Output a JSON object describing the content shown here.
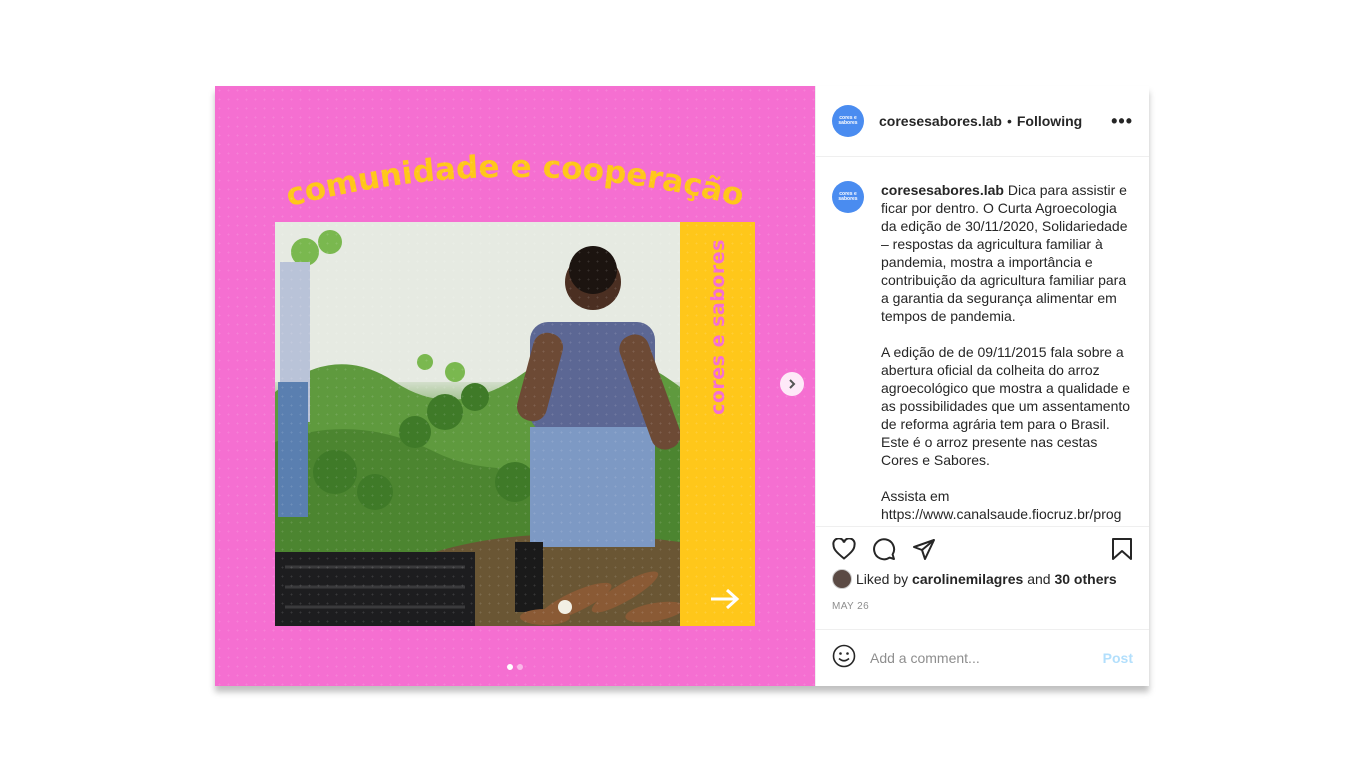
{
  "media": {
    "headline": "comunidade e cooperação",
    "brand_vertical": "cores e sabores",
    "colors": {
      "background": "#f56fd1",
      "band": "#ffc71a",
      "headline": "#ffc71a"
    },
    "slide_total": 2,
    "slide_current": 1,
    "next_icon": "chevron-right-icon"
  },
  "header": {
    "avatar_text": "cores e sabores",
    "username": "coresesabores.lab",
    "separator": "•",
    "follow_status": "Following",
    "more_icon": "more-options-icon",
    "more_label": "•••"
  },
  "caption": {
    "username": "coresesabores.lab",
    "paragraph1": "Dica para assistir e ficar por dentro. O Curta Agroecologia da edição de 30/11/2020, Solidariedade – respostas da agricultura familiar à pandemia, mostra a importância e contribuição da agricultura familiar para a garantia da segurança alimentar em tempos de pandemia.",
    "paragraph2": "A edição de de 09/11/2015 fala sobre a abertura oficial da colheita do arroz agroecológico que mostra a qualidade e as possibilidades que um assentamento de reforma agrária tem para o Brasil. Este é o arroz presente nas cestas Cores e Sabores.",
    "paragraph3": "Assista em",
    "paragraph3_cut": "https://www.canalsaude.fiocruz.br/prog"
  },
  "actions": {
    "like_icon": "heart-icon",
    "comment_icon": "comment-icon",
    "share_icon": "share-icon",
    "save_icon": "bookmark-icon"
  },
  "likes": {
    "prefix": "Liked by",
    "user": "carolinemilagres",
    "conjunction": "and",
    "others": "30 others"
  },
  "date": "MAY 26",
  "comment": {
    "emoji_icon": "emoji-icon",
    "placeholder": "Add a comment...",
    "post_label": "Post"
  }
}
